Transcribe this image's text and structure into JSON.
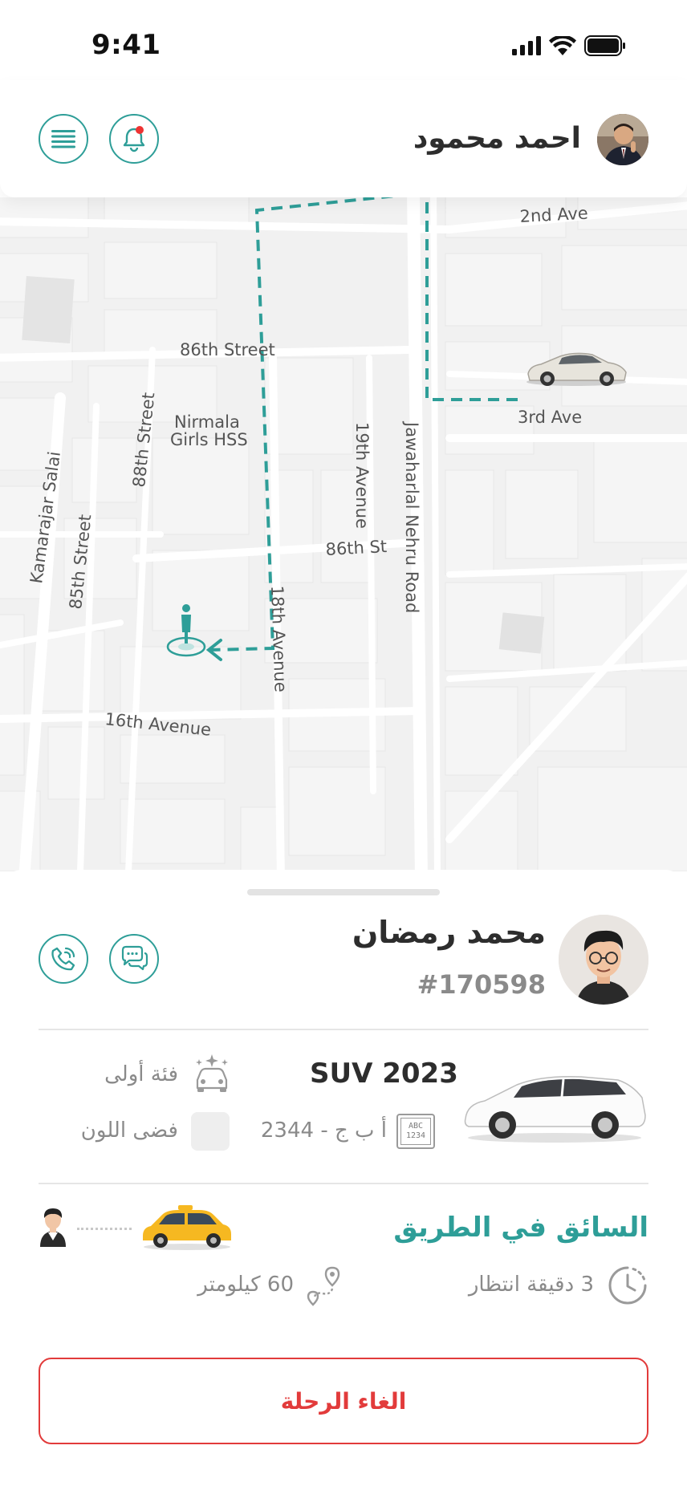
{
  "status_bar": {
    "time": "9:41"
  },
  "header": {
    "user_name": "احمد محمود"
  },
  "map": {
    "streets": {
      "a": "2nd Ave",
      "b": "86th Street",
      "c": "Nirmala",
      "d": "Girls HSS",
      "e": "88th Street",
      "f": "19th Avenue",
      "g": "Jawaharlal Nehru Road",
      "h": "3rd Ave",
      "i": "Kamarajar Salai",
      "j": "85th Street",
      "k": "86th St",
      "l": "18th Avenue",
      "m": "16th Avenue"
    }
  },
  "driver": {
    "name": "محمد رمضان",
    "id": "#170598"
  },
  "vehicle": {
    "model": "SUV 2023",
    "category": "فئة أولى",
    "plate": "أ ب ج - 2344",
    "plate_icon_text_top": "ABC",
    "plate_icon_text_bottom": "1234",
    "color_label": "فضى اللون",
    "color_swatch": "#eeeeee"
  },
  "trip": {
    "status": "السائق في الطريق",
    "wait_time": "3 دقيقة انتظار",
    "distance": "60 كيلومتر"
  },
  "actions": {
    "cancel": "الغاء الرحلة"
  },
  "colors": {
    "accent": "#2e9e98",
    "danger": "#e23b3b"
  }
}
